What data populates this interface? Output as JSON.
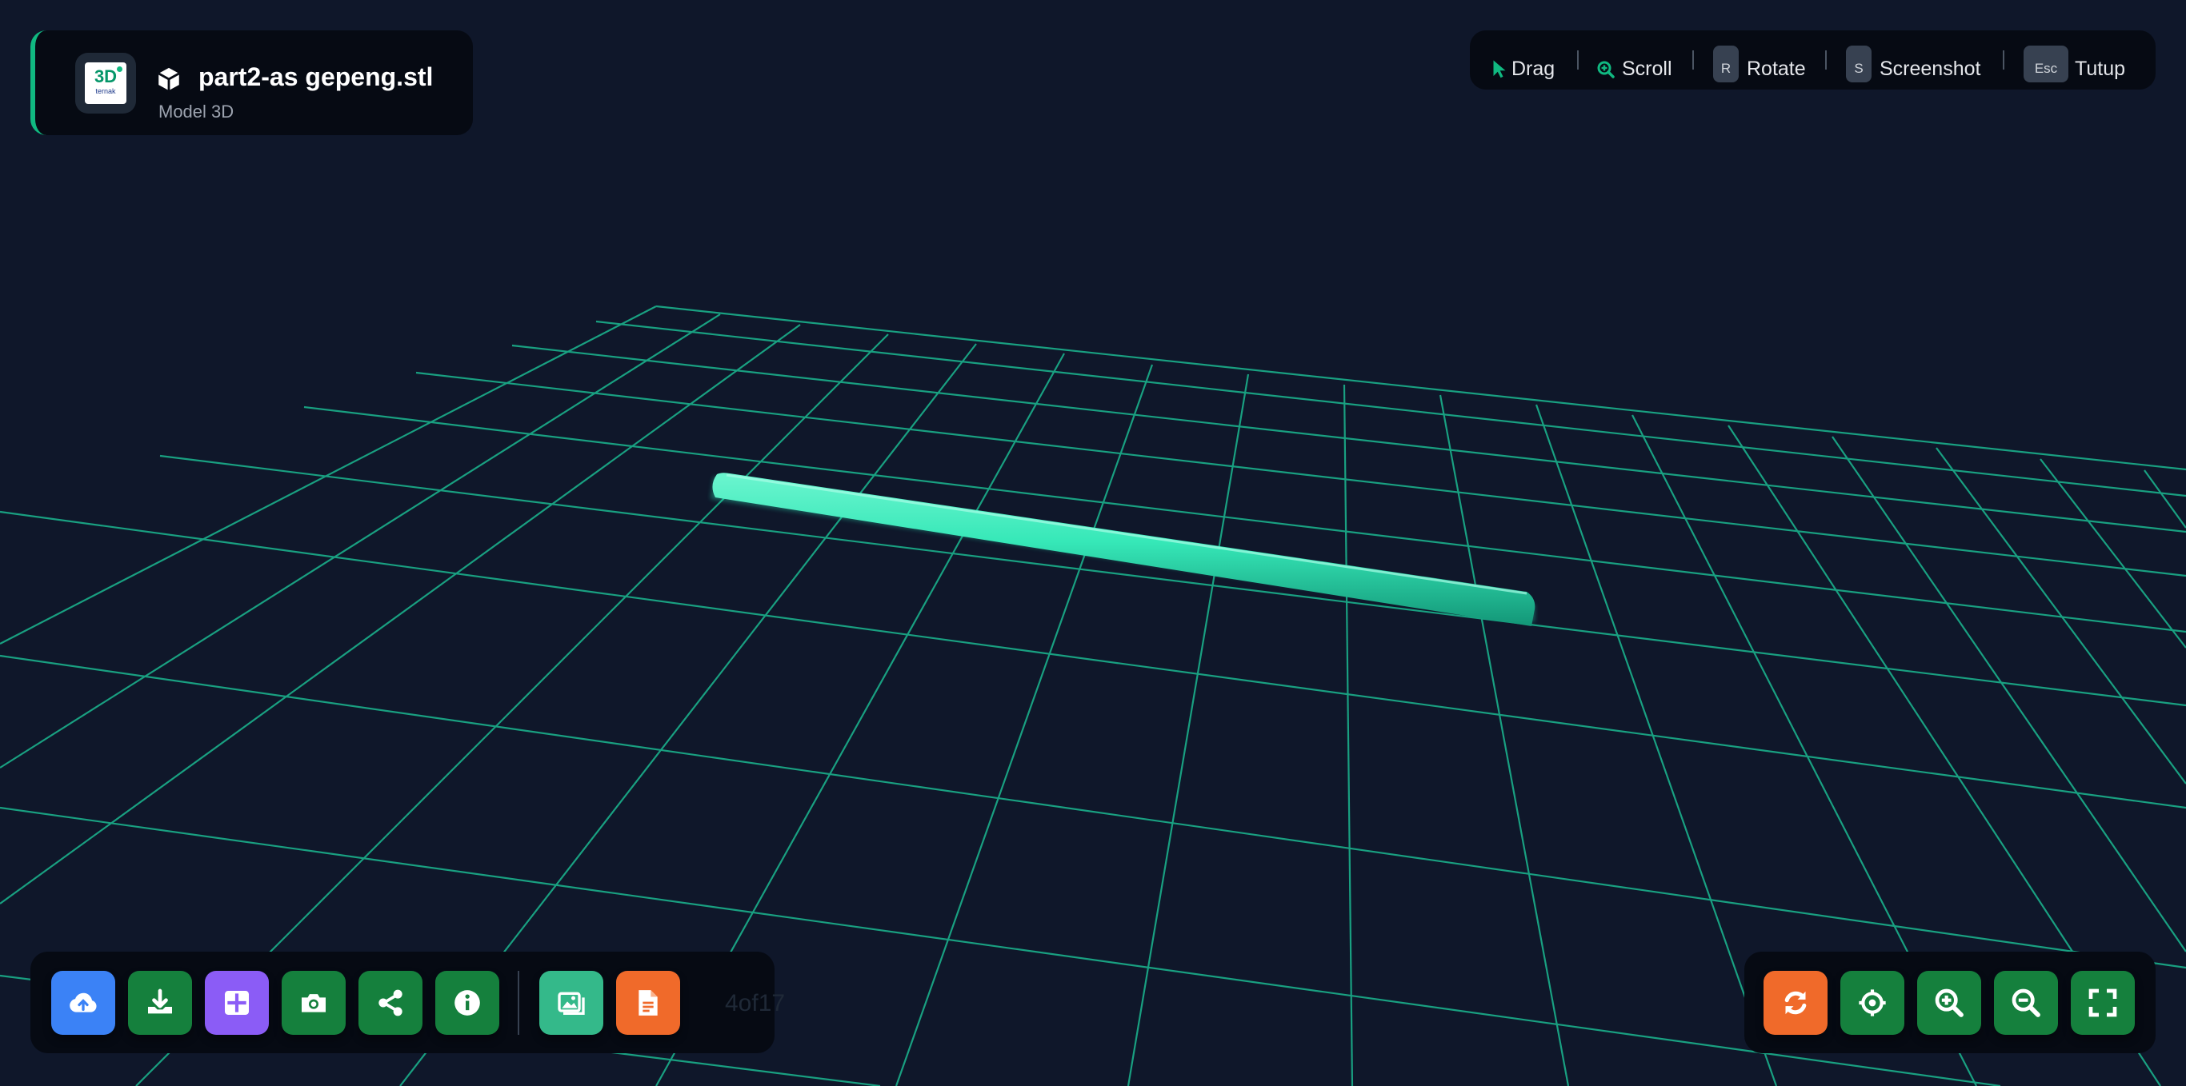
{
  "header": {
    "file_name": "part2-as gepeng.stl",
    "subtitle": "Model 3D",
    "logo_text": "3D",
    "logo_subtext": "ternak",
    "file_icon": "cube-icon",
    "accent_color": "#10b981"
  },
  "help": {
    "drag_label": "Drag",
    "scroll_label": "Scroll",
    "rotate_key": "R",
    "rotate_label": "Rotate",
    "screenshot_key": "S",
    "screenshot_label": "Screenshot",
    "close_key": "Esc",
    "close_label": "Tutup"
  },
  "left_toolbar": {
    "buttons": [
      {
        "name": "upload",
        "icon": "cloud-upload-icon",
        "color": "#3b82f6"
      },
      {
        "name": "download",
        "icon": "download-icon",
        "color": "#15803d"
      },
      {
        "name": "grid",
        "icon": "grid-icon",
        "color": "#8b5cf6"
      },
      {
        "name": "camera",
        "icon": "camera-icon",
        "color": "#15803d"
      },
      {
        "name": "share",
        "icon": "share-icon",
        "color": "#15803d"
      },
      {
        "name": "info",
        "icon": "info-icon",
        "color": "#15803d"
      },
      {
        "name": "gallery",
        "icon": "gallery-icon",
        "color": "#34b98a"
      },
      {
        "name": "document",
        "icon": "document-icon",
        "color": "#f06a2a"
      }
    ],
    "counter": "4of17"
  },
  "right_toolbar": {
    "buttons": [
      {
        "name": "reset",
        "icon": "refresh-icon",
        "color": "#f06a2a"
      },
      {
        "name": "center",
        "icon": "crosshair-icon",
        "color": "#15803d"
      },
      {
        "name": "zoom-in",
        "icon": "zoom-in-icon",
        "color": "#15803d"
      },
      {
        "name": "zoom-out",
        "icon": "zoom-out-icon",
        "color": "#15803d"
      },
      {
        "name": "fullscreen",
        "icon": "fullscreen-icon",
        "color": "#15803d"
      }
    ]
  },
  "viewport": {
    "background": "#0f172a",
    "grid_color": "#1aa886",
    "model_color": "#34e0b0"
  }
}
